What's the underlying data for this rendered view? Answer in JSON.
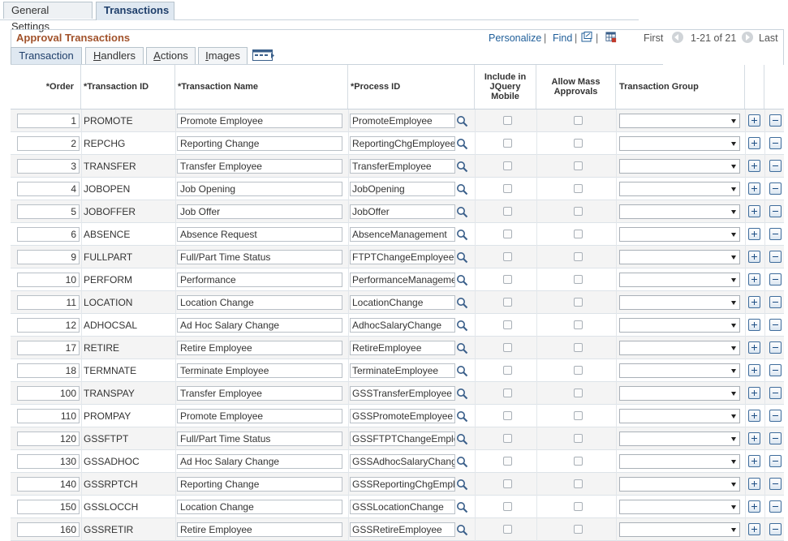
{
  "page_tabs": [
    {
      "label": "General Settings"
    },
    {
      "label": "Transactions"
    }
  ],
  "grid": {
    "title": "Approval Transactions",
    "personalize": "Personalize",
    "find": "Find",
    "first": "First",
    "range": "1-21 of 21",
    "last": "Last"
  },
  "sub_tabs": [
    {
      "label": "Transaction",
      "active": true
    },
    {
      "label": "Handlers"
    },
    {
      "label": "Actions"
    },
    {
      "label": "Images"
    }
  ],
  "columns": {
    "order": "*Order",
    "transaction_id": "*Transaction ID",
    "transaction_name": "*Transaction Name",
    "process_id": "*Process ID",
    "include_jquery": "Include in JQuery Mobile",
    "allow_mass": "Allow Mass Approvals",
    "transaction_group": "Transaction Group"
  },
  "rows": [
    {
      "order": "1",
      "id": "PROMOTE",
      "name": "Promote Employee",
      "process": "PromoteEmployee"
    },
    {
      "order": "2",
      "id": "REPCHG",
      "name": "Reporting Change",
      "process": "ReportingChgEmployee"
    },
    {
      "order": "3",
      "id": "TRANSFER",
      "name": "Transfer Employee",
      "process": "TransferEmployee"
    },
    {
      "order": "4",
      "id": "JOBOPEN",
      "name": "Job Opening",
      "process": "JobOpening"
    },
    {
      "order": "5",
      "id": "JOBOFFER",
      "name": "Job Offer",
      "process": "JobOffer"
    },
    {
      "order": "6",
      "id": "ABSENCE",
      "name": "Absence Request",
      "process": "AbsenceManagement"
    },
    {
      "order": "9",
      "id": "FULLPART",
      "name": "Full/Part Time Status",
      "process": "FTPTChangeEmployee"
    },
    {
      "order": "10",
      "id": "PERFORM",
      "name": "Performance",
      "process": "PerformanceManagement"
    },
    {
      "order": "11",
      "id": "LOCATION",
      "name": "Location Change",
      "process": "LocationChange"
    },
    {
      "order": "12",
      "id": "ADHOCSAL",
      "name": "Ad Hoc Salary Change",
      "process": "AdhocSalaryChange"
    },
    {
      "order": "17",
      "id": "RETIRE",
      "name": "Retire Employee",
      "process": "RetireEmployee"
    },
    {
      "order": "18",
      "id": "TERMNATE",
      "name": "Terminate Employee",
      "process": "TerminateEmployee"
    },
    {
      "order": "100",
      "id": "TRANSPAY",
      "name": "Transfer Employee",
      "process": "GSSTransferEmployee"
    },
    {
      "order": "110",
      "id": "PROMPAY",
      "name": "Promote Employee",
      "process": "GSSPromoteEmployee"
    },
    {
      "order": "120",
      "id": "GSSFTPT",
      "name": "Full/Part Time Status",
      "process": "GSSFTPTChangeEmployee"
    },
    {
      "order": "130",
      "id": "GSSADHOC",
      "name": "Ad Hoc Salary Change",
      "process": "GSSAdhocSalaryChange"
    },
    {
      "order": "140",
      "id": "GSSRPTCH",
      "name": "Reporting Change",
      "process": "GSSReportingChgEmployee"
    },
    {
      "order": "150",
      "id": "GSSLOCCH",
      "name": "Location Change",
      "process": "GSSLocationChange"
    },
    {
      "order": "160",
      "id": "GSSRETIR",
      "name": "Retire Employee",
      "process": "GSSRetireEmployee"
    }
  ],
  "colors": {
    "title": "#a1522b",
    "link": "#1f5e99",
    "tab_active": "#dfe8f1"
  }
}
